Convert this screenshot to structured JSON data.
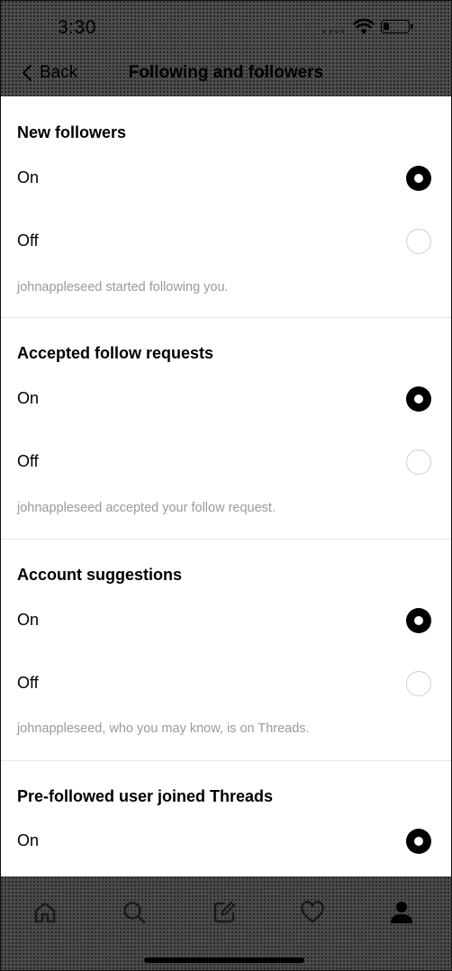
{
  "status_bar": {
    "time": "3:30"
  },
  "header": {
    "back_label": "Back",
    "title": "Following and followers"
  },
  "sections": [
    {
      "title": "New followers",
      "options": [
        {
          "label": "On",
          "selected": true
        },
        {
          "label": "Off",
          "selected": false
        }
      ],
      "example": "johnappleseed started following you."
    },
    {
      "title": "Accepted follow requests",
      "options": [
        {
          "label": "On",
          "selected": true
        },
        {
          "label": "Off",
          "selected": false
        }
      ],
      "example": "johnappleseed accepted your follow request."
    },
    {
      "title": "Account suggestions",
      "options": [
        {
          "label": "On",
          "selected": true
        },
        {
          "label": "Off",
          "selected": false
        }
      ],
      "example": "johnappleseed, who you may know, is on Threads."
    },
    {
      "title": "Pre-followed user joined Threads",
      "options": [
        {
          "label": "On",
          "selected": true
        }
      ]
    }
  ],
  "tab_bar": {
    "items": [
      {
        "icon": "home-icon"
      },
      {
        "icon": "search-icon"
      },
      {
        "icon": "compose-icon"
      },
      {
        "icon": "heart-icon"
      },
      {
        "icon": "profile-icon",
        "active": true
      }
    ]
  }
}
